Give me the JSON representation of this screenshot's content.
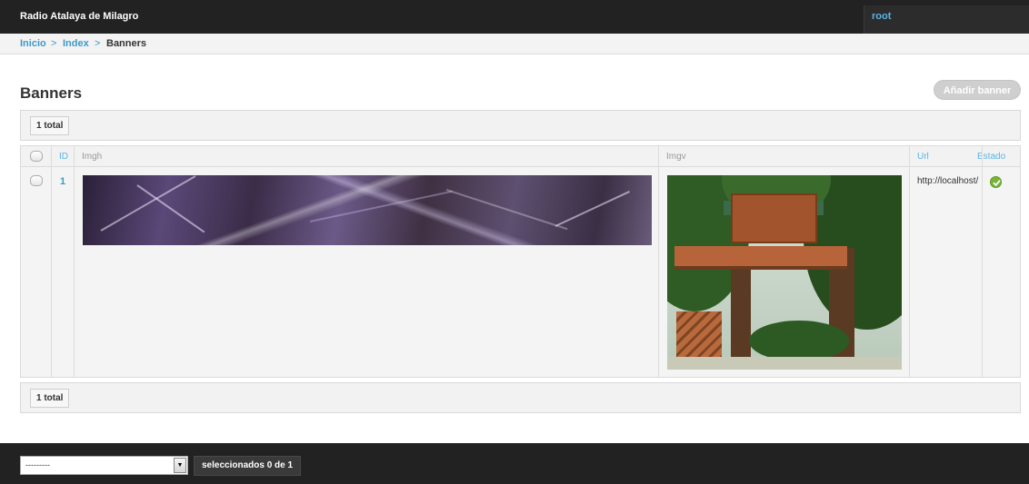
{
  "header": {
    "site_title": "Radio Atalaya de Milagro",
    "user": "root"
  },
  "breadcrumb": {
    "items": [
      "Inicio",
      "Index",
      "Banners"
    ],
    "separator": ">"
  },
  "page": {
    "title": "Banners",
    "add_button": "Añadir banner"
  },
  "paginator": {
    "count_label": "1 total"
  },
  "table": {
    "columns": [
      "ID",
      "Imgh",
      "Imgv",
      "Url",
      "Estado"
    ],
    "rows": [
      {
        "id": "1",
        "imgh": "banner-image",
        "imgv": "treehouse-image",
        "url": "http://localhost/",
        "estado": "check-icon"
      }
    ]
  },
  "footer": {
    "action_select": "---------",
    "selected_label": "seleccionados 0 de 1"
  },
  "colors": {
    "accent": "#3e99c9",
    "topbar": "#222222",
    "status_ok": "#78b438"
  }
}
